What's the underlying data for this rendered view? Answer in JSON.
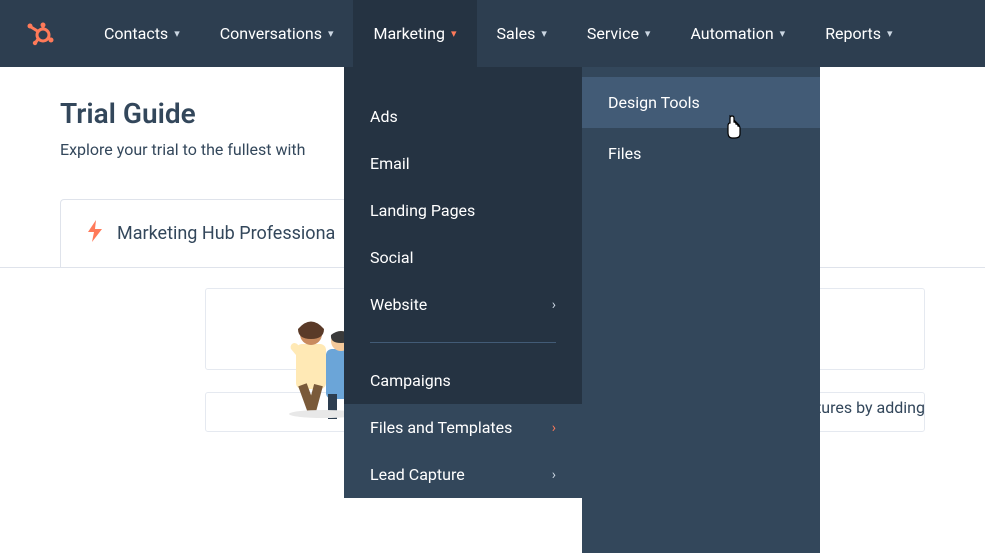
{
  "nav": {
    "contacts": "Contacts",
    "conversations": "Conversations",
    "marketing": "Marketing",
    "sales": "Sales",
    "service": "Service",
    "automation": "Automation",
    "reports": "Reports"
  },
  "page": {
    "title": "Trial Guide",
    "subtitle": "Explore your trial to the fullest with",
    "tab_label": "Marketing Hub Professiona",
    "side_text": "eatures by adding"
  },
  "dropdown": {
    "ads": "Ads",
    "email": "Email",
    "landing_pages": "Landing Pages",
    "social": "Social",
    "website": "Website",
    "campaigns": "Campaigns",
    "files_and_templates": "Files and Templates",
    "lead_capture": "Lead Capture"
  },
  "submenu": {
    "design_tools": "Design Tools",
    "files": "Files"
  }
}
